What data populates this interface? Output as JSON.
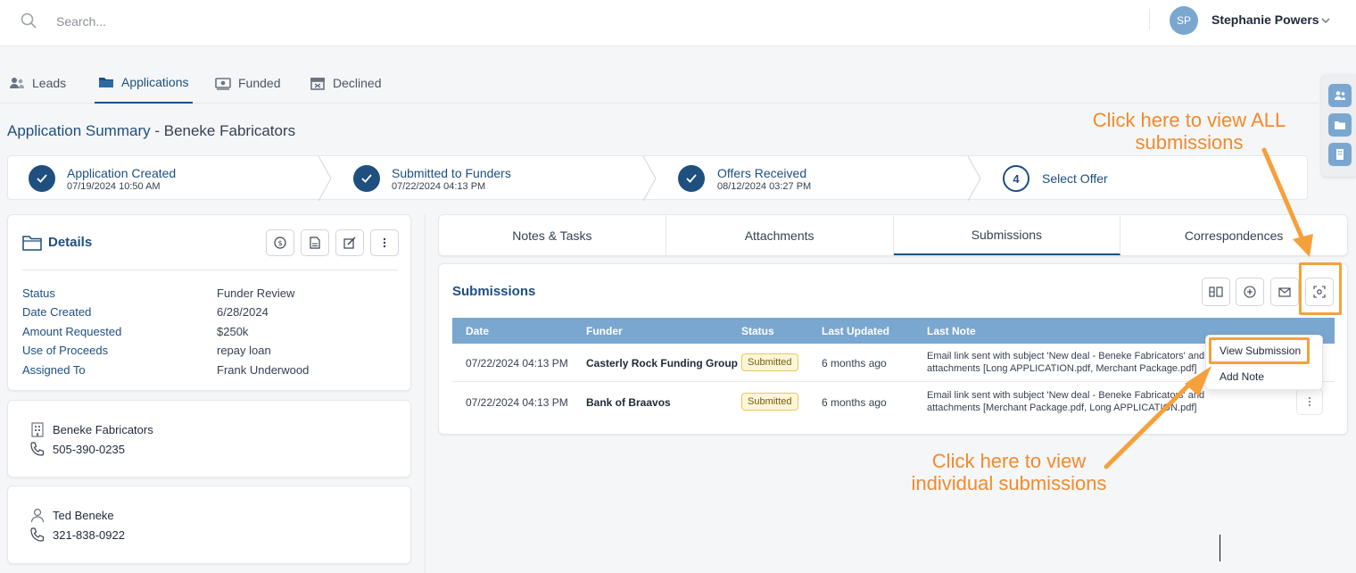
{
  "search": {
    "placeholder": "Search..."
  },
  "user": {
    "initials": "SP",
    "name": "Stephanie Powers"
  },
  "nav": [
    {
      "label": "Leads",
      "icon": "users-icon"
    },
    {
      "label": "Applications",
      "icon": "folder-icon"
    },
    {
      "label": "Funded",
      "icon": "money-icon"
    },
    {
      "label": "Declined",
      "icon": "archive-icon"
    }
  ],
  "page": {
    "title_prefix": "Application Summary",
    "title_sep": " - ",
    "title_company": "Beneke Fabricators"
  },
  "steps": [
    {
      "title": "Application Created",
      "date": "07/19/2024 10:50 AM",
      "done": true
    },
    {
      "title": "Submitted to Funders",
      "date": "07/22/2024 04:13 PM",
      "done": true
    },
    {
      "title": "Offers Received",
      "date": "08/12/2024 03:27 PM",
      "done": true
    },
    {
      "title": "Select Offer",
      "number": "4",
      "done": false
    }
  ],
  "details": {
    "title": "Details",
    "rows": [
      {
        "label": "Status",
        "value": "Funder Review"
      },
      {
        "label": "Date Created",
        "value": "6/28/2024"
      },
      {
        "label": "Amount Requested",
        "value": "$250k"
      },
      {
        "label": "Use of Proceeds",
        "value": "repay loan"
      },
      {
        "label": "Assigned To",
        "value": "Frank Underwood"
      }
    ]
  },
  "business": {
    "name": "Beneke Fabricators",
    "phone": "505-390-0235"
  },
  "contact": {
    "name": "Ted Beneke",
    "phone": "321-838-0922"
  },
  "tabs": [
    "Notes & Tasks",
    "Attachments",
    "Submissions",
    "Correspondences"
  ],
  "submissions": {
    "title": "Submissions",
    "columns": [
      "Date",
      "Funder",
      "Status",
      "Last Updated",
      "Last Note"
    ],
    "rows": [
      {
        "date": "07/22/2024 04:13 PM",
        "funder": "Casterly Rock Funding Group",
        "status": "Submitted",
        "updated": "6 months ago",
        "note1": "Email link sent with subject 'New deal - Beneke Fabricators' and",
        "note2": "attachments [Long APPLICATION.pdf, Merchant Package.pdf]"
      },
      {
        "date": "07/22/2024 04:13 PM",
        "funder": "Bank of Braavos",
        "status": "Submitted",
        "updated": "6 months ago",
        "note1": "Email link sent with subject 'New deal - Beneke Fabricators' and",
        "note2": "attachments [Merchant Package.pdf, Long APPLICATION.pdf]"
      }
    ],
    "menu": [
      "View Submission",
      "Add Note"
    ]
  },
  "annotations": {
    "all_line1": "Click here to view ALL",
    "all_line2": "submissions",
    "ind_line1": "Click here to view",
    "ind_line2": "individual submissions"
  },
  "colors": {
    "primary": "#1e4f7f",
    "header": "#7aa7cf",
    "annotation": "#f28a2a"
  }
}
